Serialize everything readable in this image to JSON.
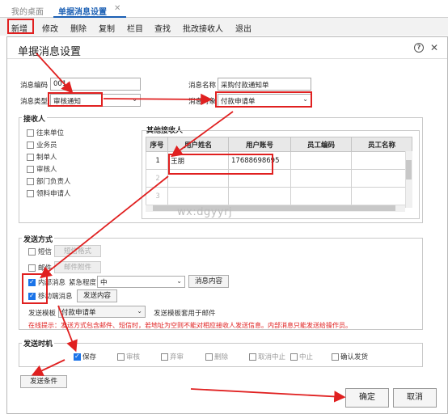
{
  "tabs": [
    {
      "label": "我的桌面"
    },
    {
      "label": "单据消息设置"
    }
  ],
  "tab_close": "✕",
  "toolbar": [
    "新增",
    "修改",
    "删除",
    "复制",
    "栏目",
    "查找",
    "批改接收人",
    "退出"
  ],
  "dialog": {
    "title": "单据消息设置",
    "help_icon": "?",
    "close_icon": "✕",
    "fields": {
      "code_label": "消息编码",
      "code_value": "001",
      "name_label": "消息名称",
      "name_value": "采购付款通知单",
      "type_label": "消息类型",
      "type_value": "审核通知",
      "object_label": "消息对象",
      "object_value": "付款申请单"
    },
    "receivers": {
      "title": "接收人",
      "items": [
        {
          "label": "往来单位",
          "checked": false
        },
        {
          "label": "业务员",
          "checked": false
        },
        {
          "label": "制单人",
          "checked": false
        },
        {
          "label": "审核人",
          "checked": false
        },
        {
          "label": "部门负责人",
          "checked": false
        },
        {
          "label": "领料申请人",
          "checked": false
        }
      ],
      "other_title": "其他接收人",
      "columns": [
        "序号",
        "用户姓名",
        "用户账号",
        "员工编码",
        "员工名称"
      ],
      "rows": [
        {
          "no": "1",
          "name": "王朋",
          "account": "17688698695",
          "emp_code": "",
          "emp_name": ""
        },
        {
          "no": "2",
          "name": "",
          "account": "",
          "emp_code": "",
          "emp_name": ""
        },
        {
          "no": "3",
          "name": "",
          "account": "",
          "emp_code": "",
          "emp_name": ""
        }
      ],
      "watermark": "wx:dgyyrj"
    },
    "send_method": {
      "title": "发送方式",
      "sms": {
        "label": "短信",
        "checked": false,
        "button": "短信格式"
      },
      "mail": {
        "label": "邮件",
        "checked": false,
        "button": "邮件附件"
      },
      "internal": {
        "label": "内部消息",
        "checked": true,
        "urgency_label": "紧急程度",
        "urgency_value": "中",
        "button": "消息内容"
      },
      "mobile": {
        "label": "移动端消息",
        "checked": true,
        "button": "发送内容"
      },
      "template_label": "发送模板",
      "template_value": "付款申请单",
      "template_note": "发送模板套用于邮件",
      "hint": "在线提示：发送方式包含邮件、短信时，若地址为空则不能对相应接收人发送信息。内部消息只能发送给操作员。"
    },
    "send_time": {
      "title": "发送时机",
      "items": [
        {
          "label": "保存",
          "checked": true
        },
        {
          "label": "审核",
          "checked": false
        },
        {
          "label": "弃审",
          "checked": false
        },
        {
          "label": "删除",
          "checked": false
        },
        {
          "label": "取消中止",
          "checked": false
        },
        {
          "label": "中止",
          "checked": false
        },
        {
          "label": "确认发货",
          "checked": false
        }
      ]
    },
    "condition_button": "发送条件",
    "ok_button": "确定",
    "cancel_button": "取消"
  },
  "colors": {
    "accent": "#1a73e8",
    "annotation": "#e02020",
    "tab_active": "#1a5fb4"
  }
}
